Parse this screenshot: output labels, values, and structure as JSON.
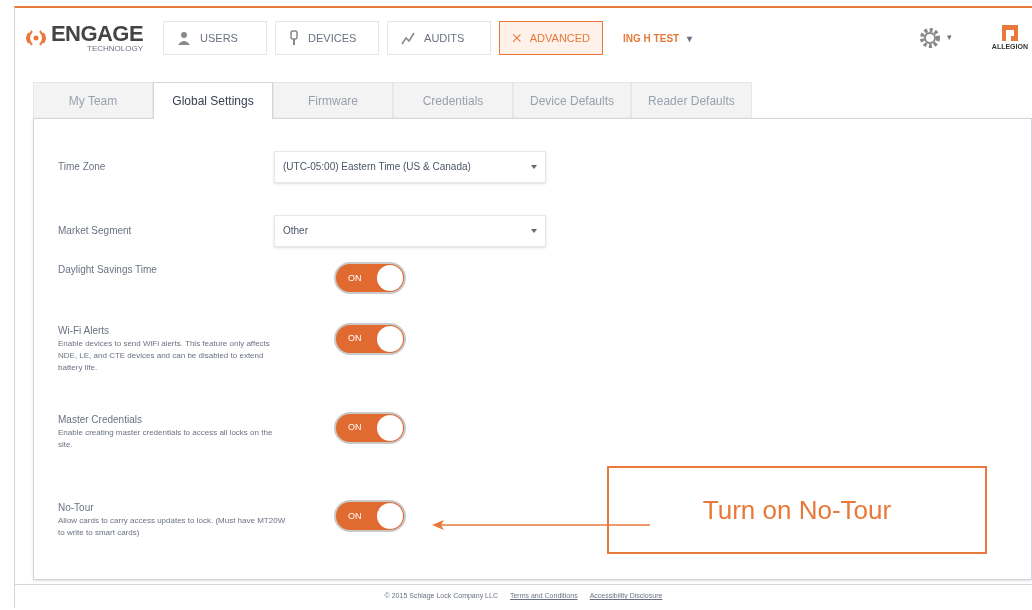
{
  "header": {
    "logo": "ENGAGE",
    "logo_sub": "TECHNOLOGY",
    "nav": [
      {
        "label": "USERS",
        "selected": false
      },
      {
        "label": "DEVICES",
        "selected": false
      },
      {
        "label": "AUDITS",
        "selected": false
      },
      {
        "label": "ADVANCED",
        "selected": true
      }
    ],
    "site": "ING H TEST",
    "site_caret": "▾",
    "settings_caret": "▾",
    "brand": "ALLEGION"
  },
  "tabs": [
    {
      "label": "My Team",
      "selected": false
    },
    {
      "label": "Global Settings",
      "selected": true
    },
    {
      "label": "Firmware",
      "selected": false
    },
    {
      "label": "Credentials",
      "selected": false
    },
    {
      "label": "Device Defaults",
      "selected": false
    },
    {
      "label": "Reader Defaults",
      "selected": false
    }
  ],
  "settings": [
    {
      "kind": "select",
      "label": "Time Zone",
      "value": "(UTC-05:00) Eastern Time (US & Canada)"
    },
    {
      "kind": "select",
      "label": "Market Segment",
      "value": "Other"
    },
    {
      "kind": "toggle",
      "label": "Daylight Savings Time",
      "on": true,
      "toggle_text": "ON"
    },
    {
      "kind": "toggle",
      "label": "Wi-Fi Alerts",
      "description": "Enable devices to send WiFi alerts. This feature only affects NDE, LE, and CTE devices and can be disabled to extend battery life.",
      "on": true,
      "toggle_text": "ON"
    },
    {
      "kind": "toggle",
      "label": "Master Credentials",
      "description": "Enable creating master credentials to access all locks on the site.",
      "on": true,
      "toggle_text": "ON"
    },
    {
      "kind": "toggle",
      "label": "No-Tour",
      "description": "Allow cards to carry access updates to lock. (Must have MT20W to write to smart cards)",
      "on": true,
      "toggle_text": "ON"
    }
  ],
  "callout": "Turn on No-Tour",
  "footer": {
    "copyright": "© 2015 Schlage Lock Company LLC",
    "links": [
      "Terms and Conditions",
      "Accessibility Disclosure"
    ]
  }
}
